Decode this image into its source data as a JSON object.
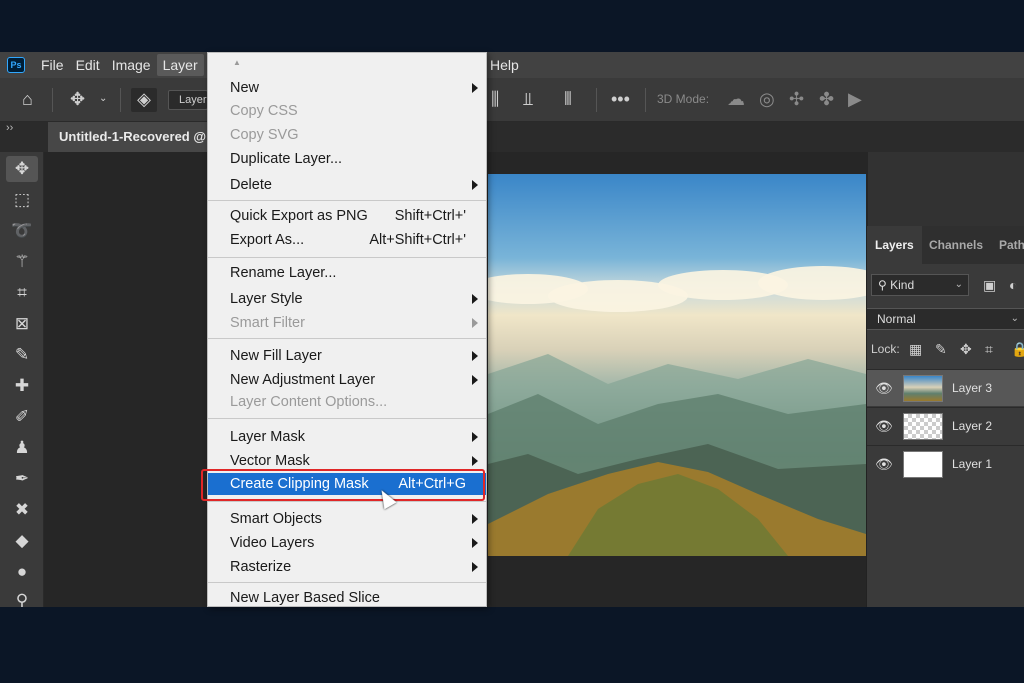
{
  "menubar": {
    "logo": "Ps",
    "items": [
      "File",
      "Edit",
      "Image",
      "Layer"
    ],
    "help": "Help"
  },
  "optionsbar": {
    "layer_select": "Layer",
    "mode3d": "3D Mode:"
  },
  "document": {
    "tab_title": "Untitled-1-Recovered @"
  },
  "layer_menu": {
    "items": [
      {
        "label": "New",
        "shortcut": "",
        "submenu": true,
        "disabled": false
      },
      {
        "label": "Copy CSS",
        "shortcut": "",
        "submenu": false,
        "disabled": true
      },
      {
        "label": "Copy SVG",
        "shortcut": "",
        "submenu": false,
        "disabled": true
      },
      {
        "label": "Duplicate Layer...",
        "shortcut": "",
        "submenu": false,
        "disabled": false
      },
      {
        "label": "Delete",
        "shortcut": "",
        "submenu": true,
        "disabled": false
      },
      {
        "label": "Quick Export as PNG",
        "shortcut": "Shift+Ctrl+'",
        "submenu": false,
        "disabled": false
      },
      {
        "label": "Export As...",
        "shortcut": "Alt+Shift+Ctrl+'",
        "submenu": false,
        "disabled": false
      },
      {
        "label": "Rename Layer...",
        "shortcut": "",
        "submenu": false,
        "disabled": false
      },
      {
        "label": "Layer Style",
        "shortcut": "",
        "submenu": true,
        "disabled": false
      },
      {
        "label": "Smart Filter",
        "shortcut": "",
        "submenu": true,
        "disabled": true
      },
      {
        "label": "New Fill Layer",
        "shortcut": "",
        "submenu": true,
        "disabled": false
      },
      {
        "label": "New Adjustment Layer",
        "shortcut": "",
        "submenu": true,
        "disabled": false
      },
      {
        "label": "Layer Content Options...",
        "shortcut": "",
        "submenu": false,
        "disabled": true
      },
      {
        "label": "Layer Mask",
        "shortcut": "",
        "submenu": true,
        "disabled": false
      },
      {
        "label": "Vector Mask",
        "shortcut": "",
        "submenu": true,
        "disabled": false
      },
      {
        "label": "Create Clipping Mask",
        "shortcut": "Alt+Ctrl+G",
        "submenu": false,
        "disabled": false,
        "highlighted": true
      },
      {
        "label": "Smart Objects",
        "shortcut": "",
        "submenu": true,
        "disabled": false
      },
      {
        "label": "Video Layers",
        "shortcut": "",
        "submenu": true,
        "disabled": false
      },
      {
        "label": "Rasterize",
        "shortcut": "",
        "submenu": true,
        "disabled": false
      },
      {
        "label": "New Layer Based Slice",
        "shortcut": "",
        "submenu": false,
        "disabled": false
      }
    ]
  },
  "layers_panel": {
    "tabs": [
      "Layers",
      "Channels",
      "Path"
    ],
    "kind_filter": "Kind",
    "blend_mode": "Normal",
    "lock_label": "Lock:",
    "layers": [
      {
        "name": "Layer 3",
        "selected": true
      },
      {
        "name": "Layer 2",
        "selected": false
      },
      {
        "name": "Layer 1",
        "selected": false
      }
    ]
  },
  "colors": {
    "highlight": "#1a6fd0",
    "callout": "#e02727",
    "ps_blue": "#31a8ff"
  }
}
